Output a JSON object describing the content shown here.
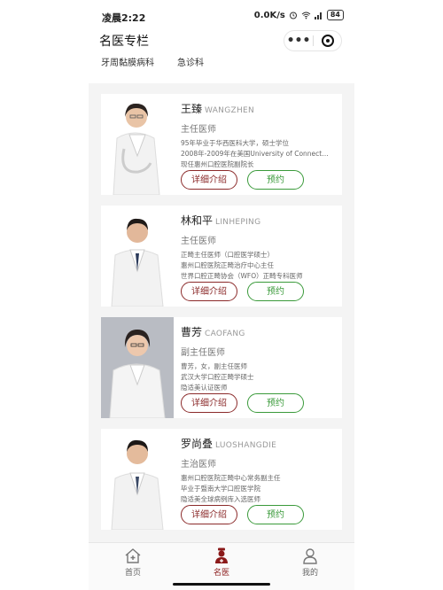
{
  "status": {
    "time": "凌晨2:22",
    "speed": "0.0K/s",
    "battery": "84"
  },
  "header": {
    "title": "名医专栏"
  },
  "categories": [
    "牙周黏膜病科",
    "急诊科"
  ],
  "doctors": [
    {
      "name": "王臻",
      "pinyin": "WANGZHEN",
      "rank": "主任医师",
      "desc": [
        "95年毕业于华西医科大学，硕士学位",
        "2008年-2009年在美国University of Connect…",
        "现任惠州口腔医院副院长"
      ],
      "detail": "详细介绍",
      "book": "预约"
    },
    {
      "name": "林和平",
      "pinyin": "LINHEPING",
      "rank": "主任医师",
      "desc": [
        "正畸主任医师（口腔医学硕士）",
        "惠州口腔医院正畸治疗中心主任",
        "世界口腔正畸协会（WFO）正畸专科医师"
      ],
      "detail": "详细介绍",
      "book": "预约"
    },
    {
      "name": "曹芳",
      "pinyin": "CAOFANG",
      "rank": "副主任医师",
      "desc": [
        "曹芳，女，副主任医师",
        "武汉大学口腔正畸学硕士",
        "隐适美认证医师"
      ],
      "detail": "详细介绍",
      "book": "预约"
    },
    {
      "name": "罗尚叠",
      "pinyin": "LUOSHANGDIE",
      "rank": "主治医师",
      "desc": [
        "惠州口腔医院正畸中心常务副主任",
        "毕业于暨南大学口腔医学院",
        "隐适美全球病例库入选医师"
      ],
      "detail": "详细介绍",
      "book": "预约"
    }
  ],
  "tabs": [
    {
      "label": "首页",
      "icon": "home-icon"
    },
    {
      "label": "名医",
      "icon": "doctor-icon"
    },
    {
      "label": "我的",
      "icon": "user-icon"
    }
  ],
  "colors": {
    "accent": "#8b1a1a",
    "book": "#3a9a3a"
  }
}
